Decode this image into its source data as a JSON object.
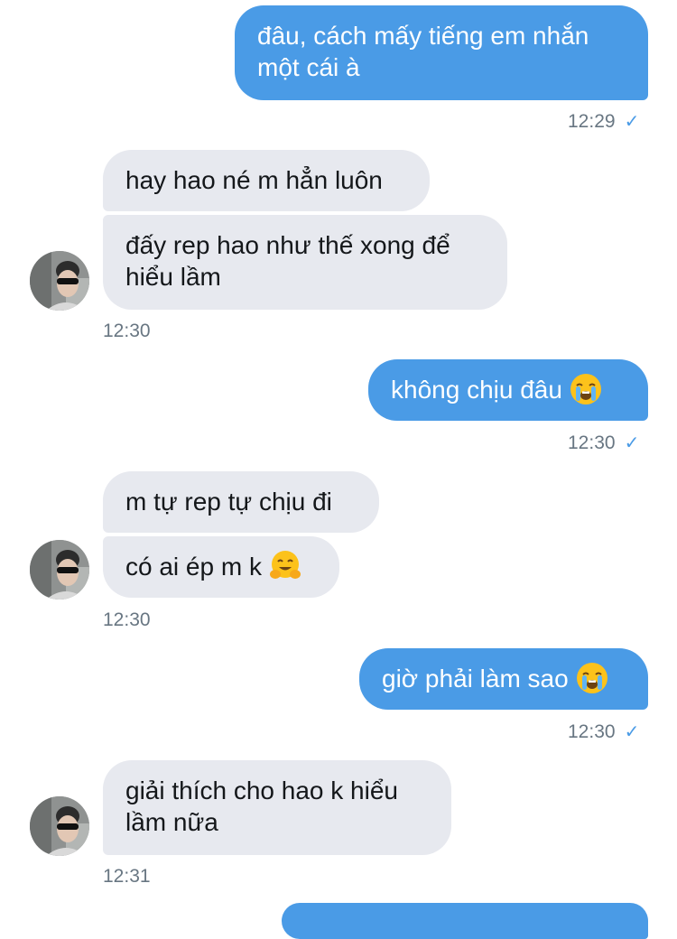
{
  "messages": [
    {
      "direction": "out",
      "text": "đâu, cách mấy tiếng em nhắn một cái à",
      "time": "12:29",
      "status_icon": "check-icon"
    },
    {
      "direction": "in",
      "text": "hay hao né m hẳn luôn"
    },
    {
      "direction": "in",
      "text": "đấy rep hao như thế xong để hiểu lầm",
      "time": "12:30"
    },
    {
      "direction": "out",
      "text": "không chịu đâu",
      "emoji": "loudly-crying-face",
      "time": "12:30",
      "status_icon": "check-icon"
    },
    {
      "direction": "in",
      "text": "m tự rep tự chịu đi"
    },
    {
      "direction": "in",
      "text": "có ai ép m k",
      "emoji": "hugging-face",
      "time": "12:30"
    },
    {
      "direction": "out",
      "text": "giờ phải làm sao",
      "emoji": "loudly-crying-face",
      "time": "12:30",
      "status_icon": "check-icon"
    },
    {
      "direction": "in",
      "text": "giải thích cho hao k hiểu lầm nữa",
      "time": "12:31"
    }
  ],
  "colors": {
    "outgoing_bubble": "#4a9be6",
    "incoming_bubble": "#e7e9ef",
    "timestamp": "#687682"
  }
}
